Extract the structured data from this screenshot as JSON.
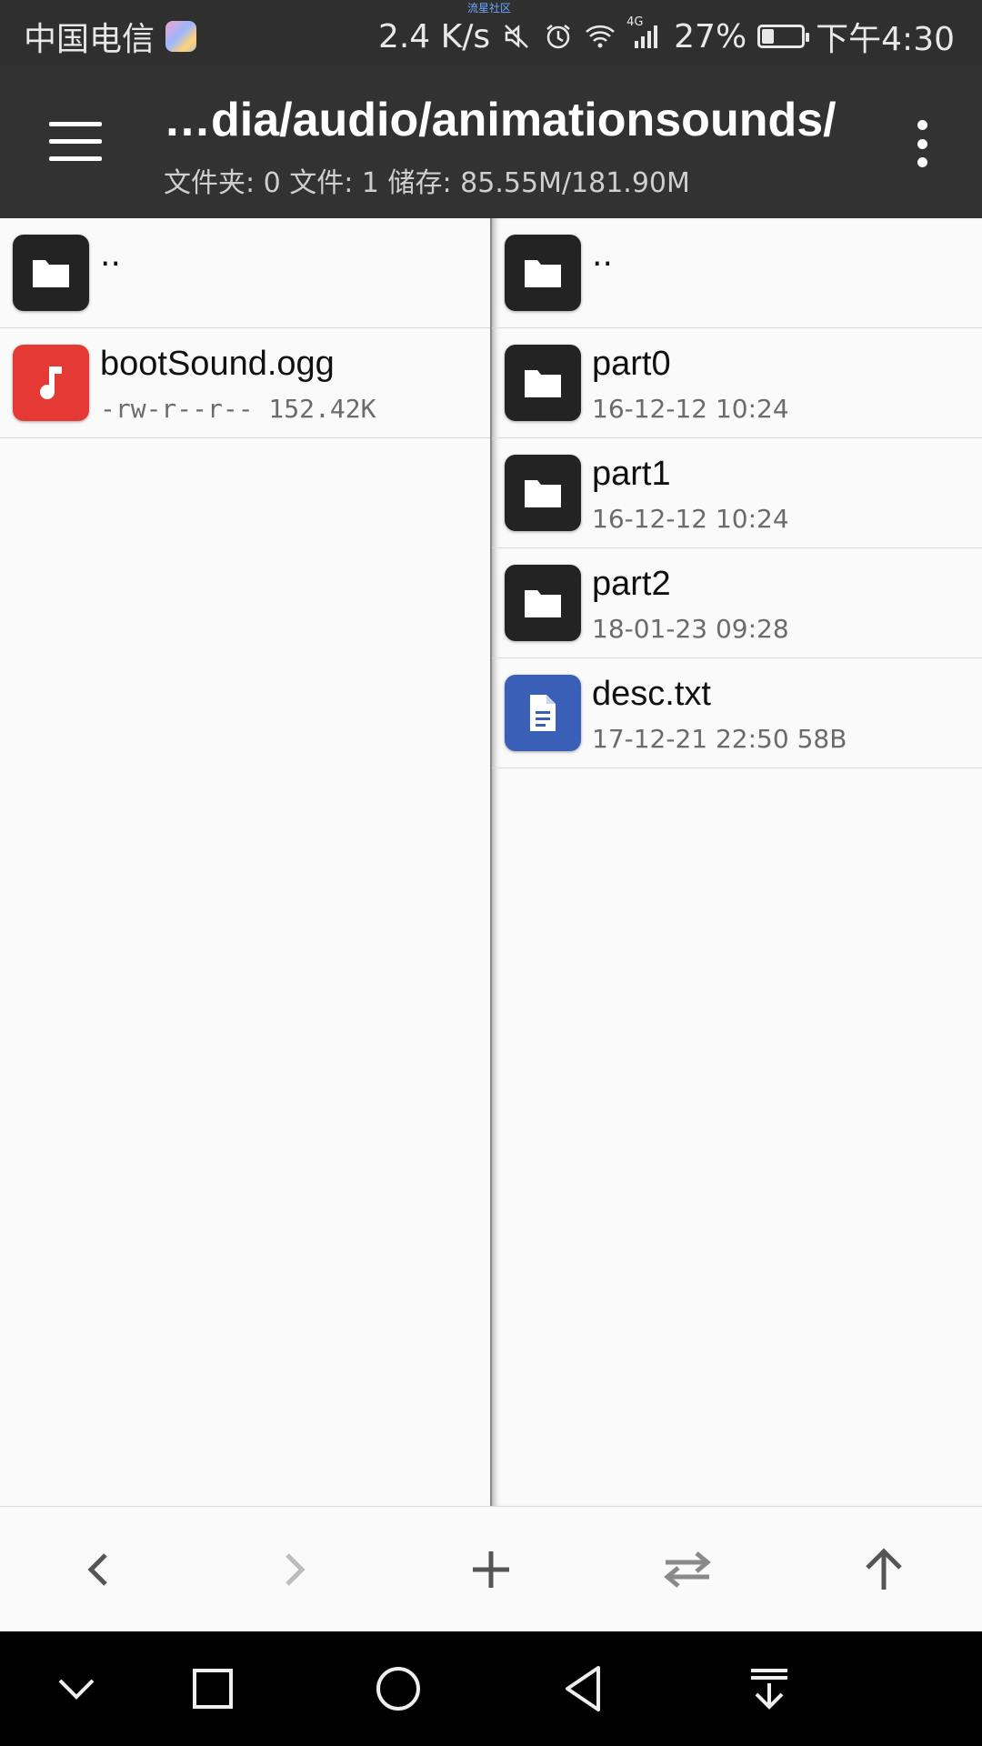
{
  "status_bar": {
    "carrier": "中国电信",
    "watermark": "流星社区",
    "net_speed": "2.4 K/s",
    "network": "4G",
    "battery_percent_text": "27%",
    "battery_level": 0.27,
    "time": "下午4:30"
  },
  "app_bar": {
    "title": "…dia/audio/animationsounds/",
    "subtitle": "文件夹: 0  文件: 1  储存: 85.55M/181.90M"
  },
  "left_pane": {
    "items": [
      {
        "type": "parent",
        "name": ".."
      },
      {
        "type": "audio",
        "name": "bootSound.ogg",
        "meta": "-rw-r--r--  152.42K"
      }
    ]
  },
  "right_pane": {
    "items": [
      {
        "type": "parent",
        "name": ".."
      },
      {
        "type": "folder",
        "name": "part0",
        "meta": "16-12-12 10:24"
      },
      {
        "type": "folder",
        "name": "part1",
        "meta": "16-12-12 10:24"
      },
      {
        "type": "folder",
        "name": "part2",
        "meta": "18-01-23 09:28"
      },
      {
        "type": "document",
        "name": "desc.txt",
        "meta": "17-12-21 22:50  58B"
      }
    ]
  },
  "toolbar": {
    "buttons": [
      "back-icon",
      "forward-icon",
      "add-icon",
      "swap-icon",
      "up-icon"
    ]
  },
  "nav_bar": {
    "buttons": [
      "hide-icon",
      "recents-icon",
      "home-icon",
      "back-icon",
      "notifications-icon"
    ]
  },
  "colors": {
    "app_bar": "#323232",
    "audio_icon": "#e53935",
    "document_icon": "#3a5fb7",
    "folder_icon": "#232323"
  }
}
